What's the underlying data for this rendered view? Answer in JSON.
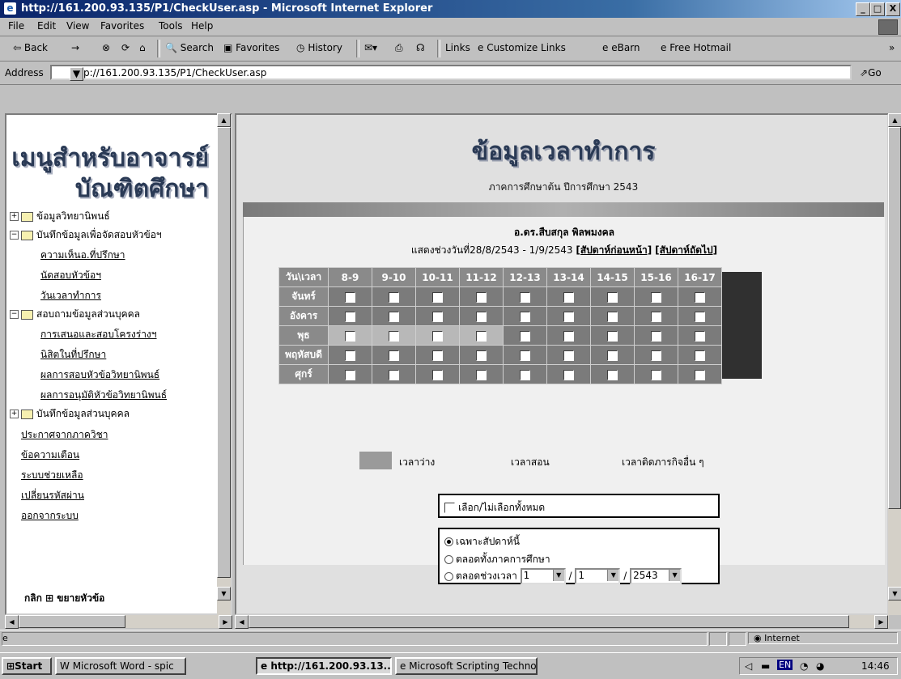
{
  "window": {
    "title": "http://161.200.93.135/P1/CheckUser.asp - Microsoft Internet Explorer",
    "controls": [
      "_",
      "□",
      "X"
    ]
  },
  "menu": [
    "File",
    "Edit",
    "View",
    "Favorites",
    "Tools",
    "Help"
  ],
  "toolbar": {
    "back": "⇦ Back",
    "forward": "→",
    "search": "Search",
    "favorites": "Favorites",
    "history": "History",
    "links": "Links",
    "customize_links": "Customize Links",
    "ebarn": "eBarn",
    "free_hotmail": "Free Hotmail",
    "more": "»"
  },
  "address": {
    "label": "Address",
    "url": "http://161.200.93.135/P1/CheckUser.asp",
    "go": "Go"
  },
  "sidebar": {
    "heading_line1": "เมนูสำหรับอาจารย์",
    "heading_line2": "บัณฑิตศึกษา",
    "items": [
      {
        "label": "ข้อมูลวิทยานิพนธ์"
      },
      {
        "label": "บันทึกข้อมูลเพื่อจัดสอบหัวข้อฯ"
      },
      {
        "label": "ความเห็นอ.ที่ปรึกษา"
      },
      {
        "label": "นัดสอบหัวข้อฯ"
      },
      {
        "label": "วันเวลาทำการ"
      },
      {
        "label": "สอบถามข้อมูลส่วนบุคคล"
      },
      {
        "label": "การเสนอและสอบโครงร่างฯ"
      },
      {
        "label": "นิสิตในที่ปรึกษา"
      },
      {
        "label": "ผลการสอบหัวข้อวิทยานิพนธ์"
      },
      {
        "label": "ผลการอนุมัติหัวข้อวิทยานิพนธ์"
      },
      {
        "label": "บันทึกข้อมูลส่วนบุคคล"
      },
      {
        "label": "ประกาศจากภาควิชา"
      },
      {
        "label": "ข้อความเตือน"
      },
      {
        "label": "ระบบช่วยเหลือ"
      },
      {
        "label": "เปลี่ยนรหัสผ่าน"
      },
      {
        "label": "ออกจากระบบ"
      }
    ],
    "footer": "กลิก ⊞ ขยายหัวข้อ"
  },
  "main": {
    "title": "ข้อมูลเวลาทำการ",
    "subtitle": "ภาคการศึกษาต้น ปีการศึกษา 2543",
    "name": "อ.ดร.สืบสกุล พิลพมงคล",
    "range": "แสดงช่วงวันที่28/8/2543 - 1/9/2543",
    "prev_week": "[สัปดาห์ก่อนหน้า]",
    "next_week": "[สัปดาห์ถัดไป]",
    "table": {
      "corner": "วัน\\เวลา",
      "times": [
        "8-9",
        "9-10",
        "10-11",
        "11-12",
        "12-13",
        "13-14",
        "14-15",
        "15-16",
        "16-17"
      ],
      "days": [
        "จันทร์",
        "อังคาร",
        "พุธ",
        "พฤหัสบดี",
        "ศุกร์"
      ]
    },
    "legend": {
      "free": "เวลาว่าง",
      "teaching": "เวลาสอน",
      "busy": "เวลาติดภารกิจอื่น ๆ"
    },
    "select_all": "เลือก/ไม่เลือกทั้งหมด",
    "options": {
      "this_week": "เฉพาะสัปดาห์นี้",
      "whole_term": "ตลอดทั้งภาคการศึกษา",
      "period": "ตลอดช่วงเวลา",
      "day": "1",
      "month": "1",
      "year": "2543",
      "slash": "/"
    }
  },
  "status": {
    "left": "",
    "zone": "Internet"
  },
  "taskbar": {
    "start": "Start",
    "tasks": [
      "Microsoft Word - spic",
      "http://161.200.93.13...",
      "Microsoft Scripting Techno..."
    ],
    "clock": "14:46",
    "tray": "EN"
  }
}
